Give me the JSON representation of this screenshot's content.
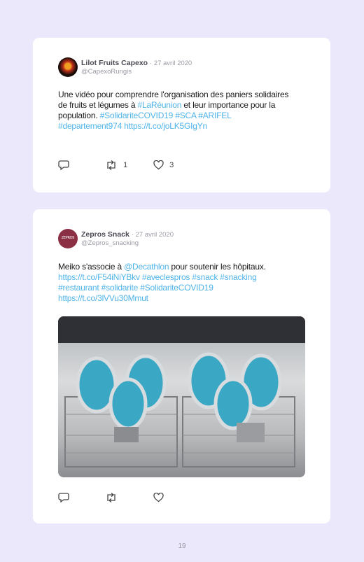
{
  "tweets": [
    {
      "author": "Lilot Fruits Capexo",
      "date": "· 27 avril 2020",
      "handle": "@CapexoRungis",
      "text_parts": [
        {
          "t": "Une vidéo pour comprendre l'organisation des paniers solidaires de fruits et légumes à "
        },
        {
          "t": "#LaRéunion",
          "link": true
        },
        {
          "t": " et leur importance pour la population. "
        },
        {
          "t": "#SolidariteCOVID19 #SCA #ARIFEL #departement974 https://t.co/joLK5GIgYn",
          "link": true
        }
      ],
      "retweets": "1",
      "likes": "3"
    },
    {
      "author": "Zepros Snack",
      "date": "· 27 avril 2020",
      "handle": "@Zepros_snacking",
      "avatar_text": "ZEPROS",
      "text_parts": [
        {
          "t": "Meiko s'associe à "
        },
        {
          "t": "@Decathlon",
          "link": true
        },
        {
          "t": " pour soutenir les hôpitaux. "
        },
        {
          "t": "https://t.co/F54iNiYBkv #aveclespros #snack #snacking #restaurant #solidarite #SolidariteCOVID19 https://t.co/3lVVu30Mmut",
          "link": true
        }
      ],
      "retweets": "",
      "likes": ""
    }
  ],
  "page_number": "19",
  "colors": {
    "background": "#ebe8fb",
    "link": "#4fb3e8",
    "card": "#ffffff"
  },
  "icons": [
    "reply-icon",
    "retweet-icon",
    "heart-icon"
  ]
}
